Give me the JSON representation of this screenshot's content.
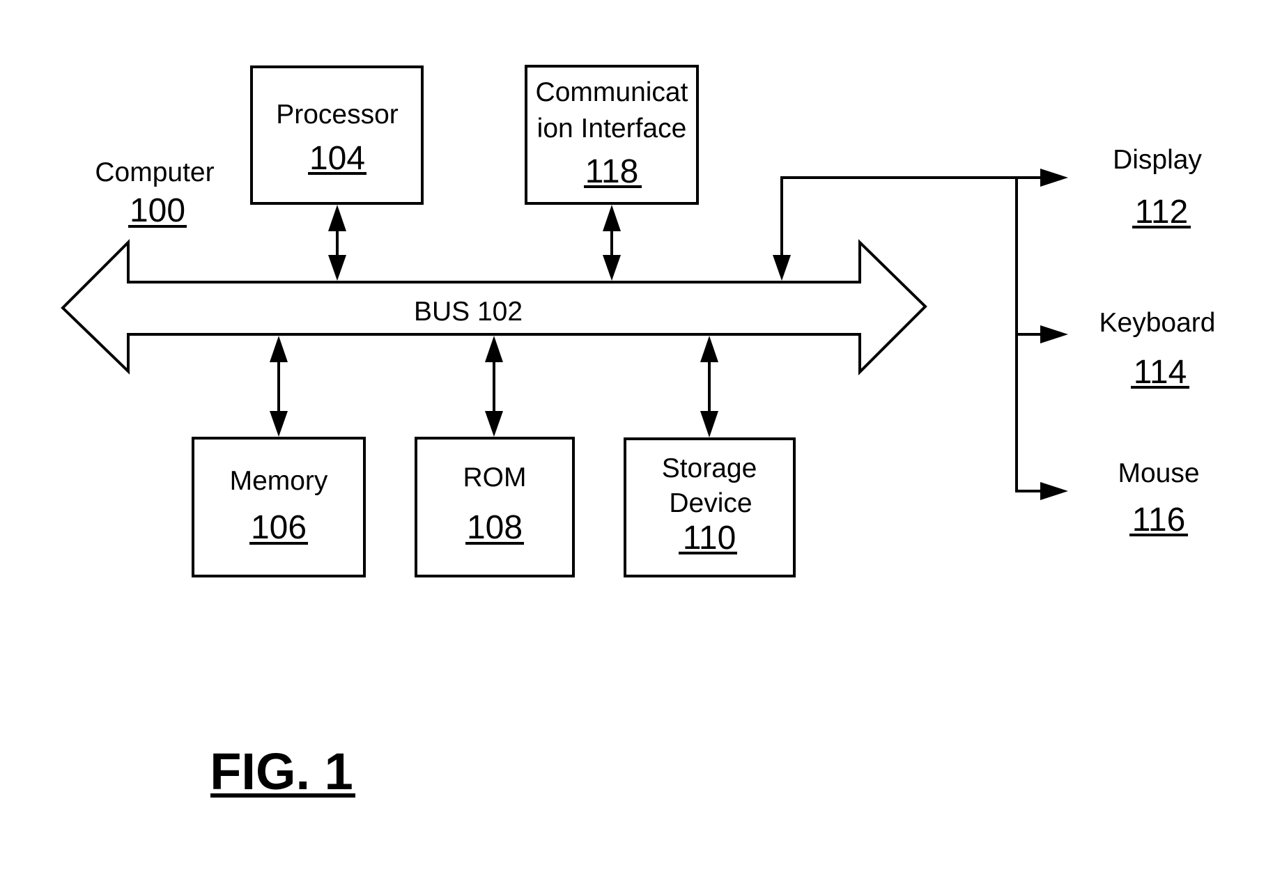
{
  "figure": {
    "caption": "FIG. 1",
    "system": {
      "label": "Computer",
      "ref": "100"
    },
    "bus": {
      "label": "BUS 102"
    },
    "components": {
      "processor": {
        "label": "Processor",
        "ref": "104"
      },
      "communication_interface": {
        "label_line1": "Communicat",
        "label_line2": "ion Interface",
        "ref": "118"
      },
      "memory": {
        "label": "Memory",
        "ref": "106"
      },
      "rom": {
        "label": "ROM",
        "ref": "108"
      },
      "storage_device": {
        "label_line1": "Storage",
        "label_line2": "Device",
        "ref": "110"
      }
    },
    "peripherals": {
      "display": {
        "label": "Display",
        "ref": "112"
      },
      "keyboard": {
        "label": "Keyboard",
        "ref": "114"
      },
      "mouse": {
        "label": "Mouse",
        "ref": "116"
      }
    },
    "colors": {
      "ink": "#000000",
      "background": "#ffffff"
    }
  }
}
